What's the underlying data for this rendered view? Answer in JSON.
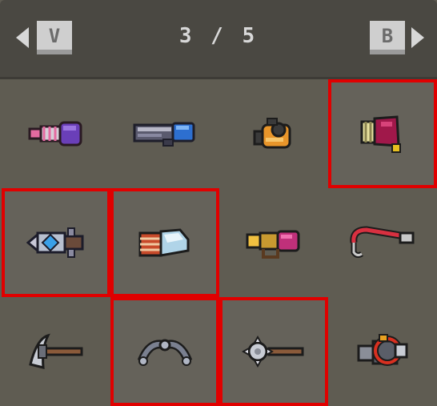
{
  "header": {
    "prev_key": "V",
    "next_key": "B",
    "page_current": "3",
    "page_separator": "/",
    "page_total": "5"
  },
  "colors": {
    "selection": "#e00000",
    "panel": "#5f5c52",
    "header": "#4a4842"
  },
  "grid": {
    "columns": 4,
    "rows": 3,
    "items": [
      {
        "icon": "purple-drill-gun-icon",
        "selected": false
      },
      {
        "icon": "blue-rail-gun-icon",
        "selected": false
      },
      {
        "icon": "orange-blaster-icon",
        "selected": false
      },
      {
        "icon": "crimson-cannon-icon",
        "selected": true
      },
      {
        "icon": "blue-crystal-launcher-icon",
        "selected": true
      },
      {
        "icon": "striped-gauntlet-icon",
        "selected": true
      },
      {
        "icon": "gold-pink-blaster-icon",
        "selected": false
      },
      {
        "icon": "red-grapple-hook-icon",
        "selected": false
      },
      {
        "icon": "pickaxe-icon",
        "selected": false
      },
      {
        "icon": "chain-boomerang-icon",
        "selected": true
      },
      {
        "icon": "spiked-mace-icon",
        "selected": true
      },
      {
        "icon": "red-ring-cannon-icon",
        "selected": false
      }
    ]
  }
}
